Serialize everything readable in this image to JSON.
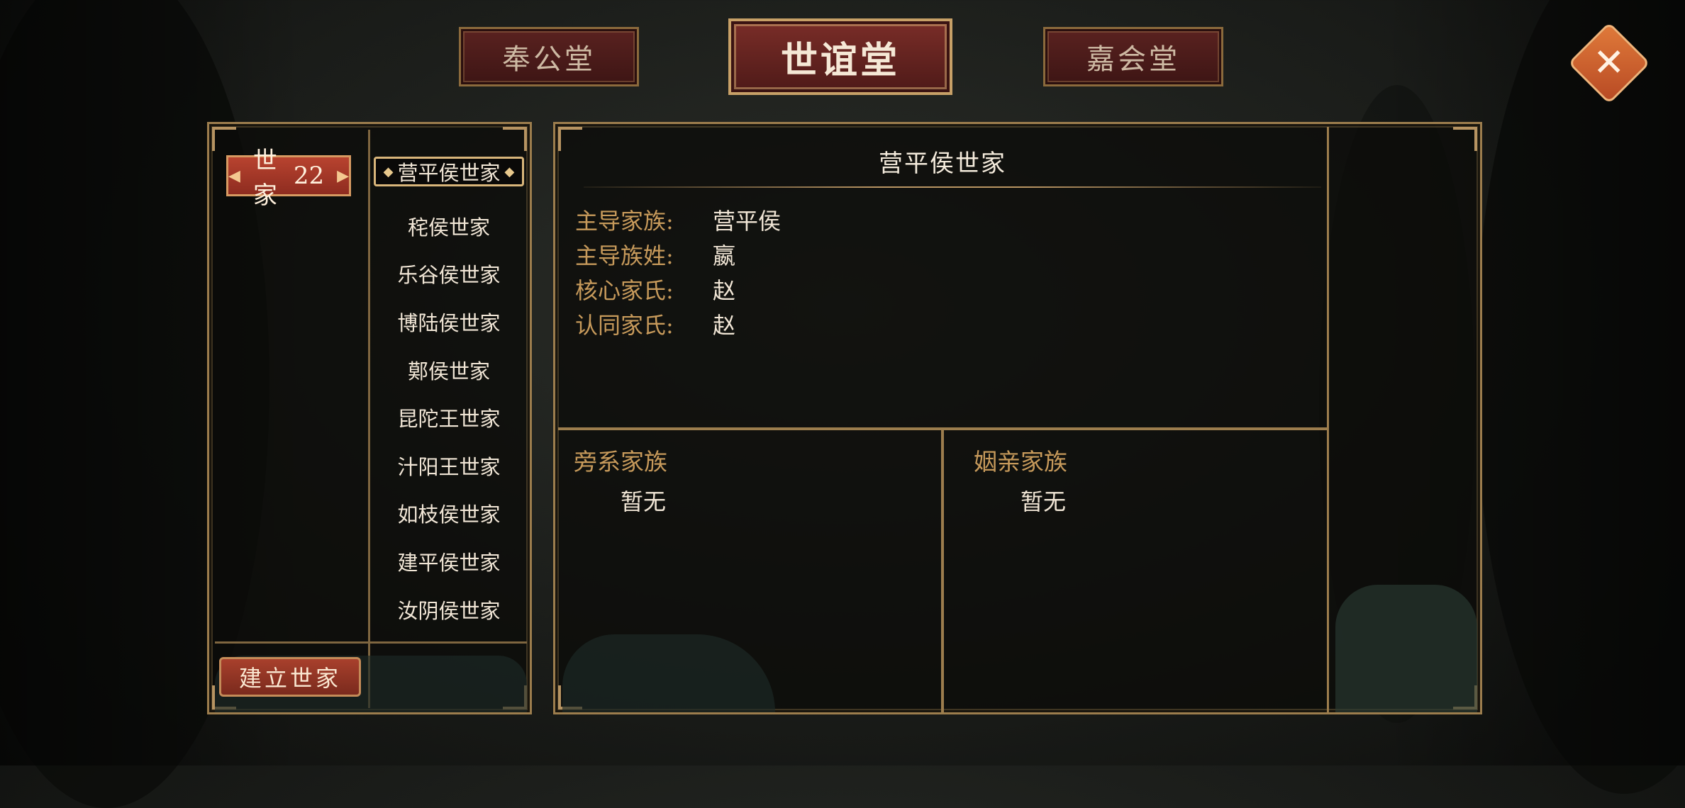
{
  "tabs": [
    {
      "label": "奉公堂",
      "active": false
    },
    {
      "label": "世谊堂",
      "active": true
    },
    {
      "label": "嘉会堂",
      "active": false
    }
  ],
  "close_icon": "close-icon",
  "sidebar": {
    "category_label": "世家",
    "category_count": "22",
    "build_button": "建立世家"
  },
  "families": [
    {
      "label": "营平侯世家",
      "display": "营平侯世家",
      "selected": true
    },
    {
      "label": "秺侯世家",
      "display": "秺侯世家"
    },
    {
      "label": "乐谷侯世家",
      "display": "乐谷侯世家"
    },
    {
      "label": "博陆侯世家",
      "display": "博陆侯世家"
    },
    {
      "label": "鄚侯世家",
      "display": "鄚侯世家"
    },
    {
      "label": "昆陀王世家",
      "display": "昆陀王世家"
    },
    {
      "label": "汁阳王世家",
      "display": "汁阳王世家"
    },
    {
      "label": "如枝侯世家",
      "display": "如枝侯世家"
    },
    {
      "label": "建平侯世家",
      "display": "建平侯世家"
    },
    {
      "label": "汝阴侯世家",
      "display": "汝阴侯世家"
    }
  ],
  "detail": {
    "title": "营平侯世家",
    "rows": [
      {
        "label": "主导家族:",
        "value": "营平侯"
      },
      {
        "label": "主导族姓:",
        "value": "嬴"
      },
      {
        "label": "核心家氏:",
        "value": "赵"
      },
      {
        "label": "认同家氏:",
        "value": "赵"
      }
    ],
    "branch_title": "旁系家族",
    "branch_value": "暂无",
    "inlaw_title": "姻亲家族",
    "inlaw_value": "暂无"
  },
  "colors": {
    "accent_gold": "#c79a5b",
    "tab_red": "#5a2220",
    "button_red": "#b8432f",
    "close_orange": "#e07a3a"
  }
}
